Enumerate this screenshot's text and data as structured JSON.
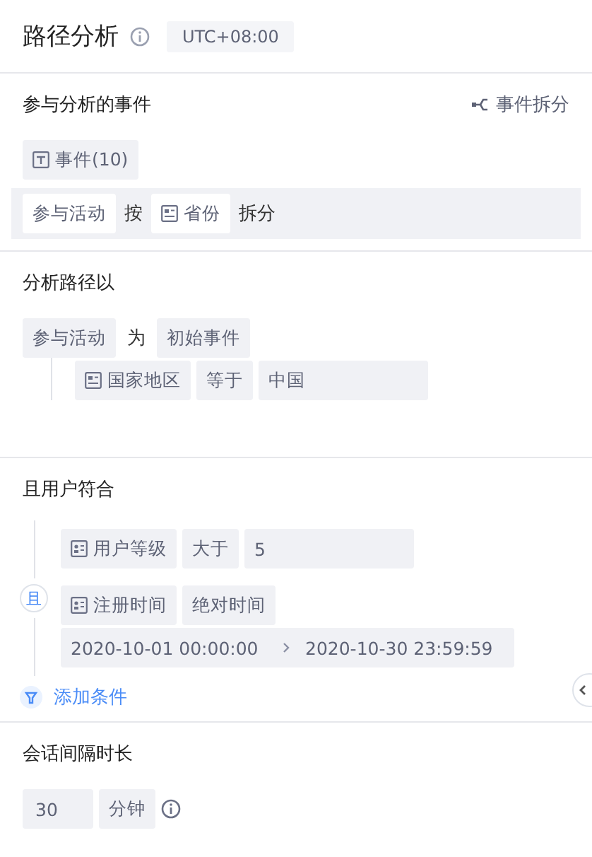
{
  "header": {
    "title": "路径分析",
    "timezone": "UTC+08:00"
  },
  "events_section": {
    "title": "参与分析的事件",
    "split_link": "事件拆分",
    "event_chip": "事件(10)",
    "split_row": [
      {
        "kind": "chip",
        "text": "参与活动"
      },
      {
        "kind": "word",
        "text": "按"
      },
      {
        "kind": "prop",
        "text": "省份"
      },
      {
        "kind": "word",
        "text": "拆分"
      }
    ]
  },
  "path_section": {
    "title": "分析路径以",
    "row": [
      {
        "kind": "chip",
        "text": "参与活动"
      },
      {
        "kind": "word",
        "text": "为"
      },
      {
        "kind": "chip",
        "text": "初始事件"
      }
    ],
    "filter": [
      {
        "kind": "prop",
        "text": "国家地区"
      },
      {
        "kind": "chip",
        "text": "等于"
      },
      {
        "kind": "value",
        "text": "中国"
      }
    ]
  },
  "user_section": {
    "title": "且用户符合",
    "logic": "且",
    "conditions": [
      {
        "parts": [
          {
            "kind": "user",
            "text": "用户等级"
          },
          {
            "kind": "chip",
            "text": "大于"
          },
          {
            "kind": "value",
            "text": "5"
          }
        ]
      },
      {
        "parts": [
          {
            "kind": "user",
            "text": "注册时间"
          },
          {
            "kind": "chip",
            "text": "绝对时间"
          }
        ],
        "range": {
          "start": "2020-10-01 00:00:00",
          "end": "2020-10-30 23:59:59"
        }
      }
    ],
    "add": "添加条件"
  },
  "session_section": {
    "title": "会话间隔时长",
    "value": "30",
    "unit": "分钟"
  }
}
